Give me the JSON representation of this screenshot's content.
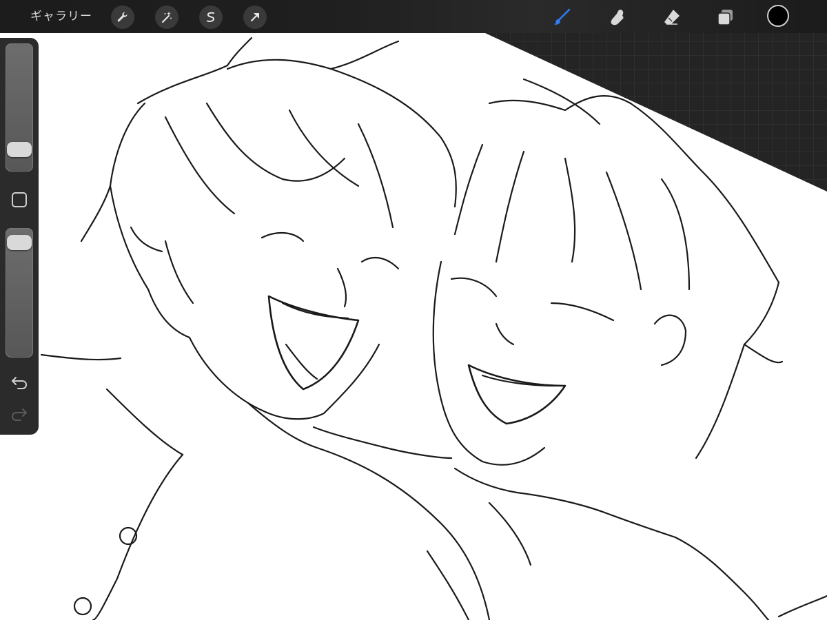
{
  "topbar": {
    "gallery_label": "ギャラリー",
    "left_tools": [
      {
        "icon": "wrench-icon",
        "name": "actions"
      },
      {
        "icon": "magic-wand-icon",
        "name": "adjustments"
      },
      {
        "icon": "selection-s-icon",
        "name": "selection"
      },
      {
        "icon": "arrow-cursor-icon",
        "name": "transform"
      }
    ],
    "right_tools": [
      {
        "icon": "brush-icon",
        "name": "paint",
        "active": true
      },
      {
        "icon": "smudge-finger-icon",
        "name": "smudge"
      },
      {
        "icon": "eraser-icon",
        "name": "eraser"
      },
      {
        "icon": "layers-icon",
        "name": "layers"
      }
    ],
    "current_color": "#000000",
    "active_tool_color": "#2f7cf6"
  },
  "sidebar": {
    "brush_size_level": 0.12,
    "brush_opacity_level": 0.95,
    "modify_button_icon": "square-modify-icon",
    "undo_icon": "undo-icon",
    "redo_icon": "redo-icon",
    "redo_enabled": false
  },
  "canvas": {
    "content": "line-art-sketch",
    "background": "#ffffff",
    "workspace_color": "#242424"
  }
}
